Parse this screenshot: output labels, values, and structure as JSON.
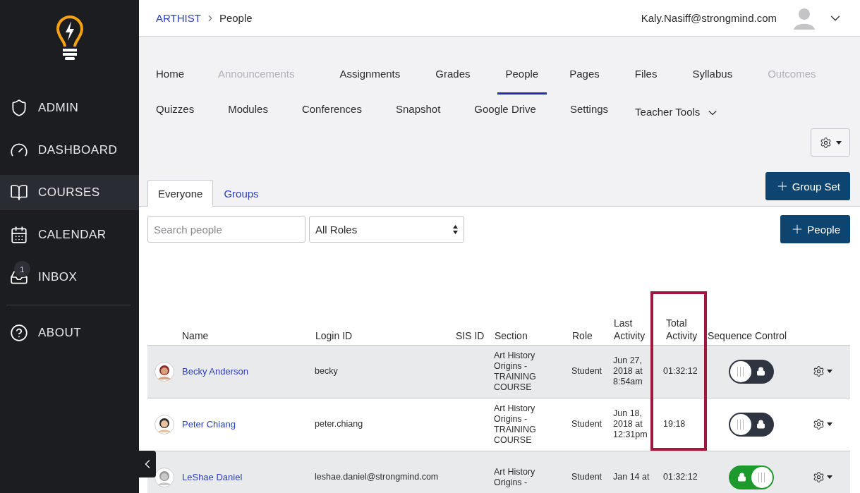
{
  "header": {
    "breadcrumb": [
      {
        "label": "ARTHIST",
        "kind": "link"
      },
      {
        "label": "People",
        "kind": "current"
      }
    ],
    "user_email": "Kaly.Nasiff@strongmind.com"
  },
  "sidebar": {
    "items": [
      {
        "label": "ADMIN",
        "selected": false
      },
      {
        "label": "DASHBOARD",
        "selected": false
      },
      {
        "label": "COURSES",
        "selected": true
      },
      {
        "label": "CALENDAR",
        "selected": false
      },
      {
        "label": "INBOX",
        "selected": false,
        "badge": "1"
      }
    ],
    "footer_items": [
      {
        "label": "ABOUT",
        "selected": false
      }
    ]
  },
  "course_nav": [
    {
      "links": [
        {
          "label": "Home",
          "kind": "link",
          "disabled": false,
          "selected": false
        },
        {
          "label": "Announcements",
          "kind": "link",
          "disabled": true,
          "selected": false
        },
        {
          "label": "Assignments",
          "kind": "link",
          "disabled": false,
          "selected": false
        },
        {
          "label": "Grades",
          "kind": "link",
          "disabled": false,
          "selected": false
        },
        {
          "label": "People",
          "kind": "link",
          "disabled": false,
          "selected": true
        },
        {
          "label": "Pages",
          "kind": "link",
          "disabled": false,
          "selected": false
        },
        {
          "label": "Files",
          "kind": "link",
          "disabled": false,
          "selected": false
        },
        {
          "label": "Syllabus",
          "kind": "link",
          "disabled": false,
          "selected": false
        },
        {
          "label": "Outcomes",
          "kind": "link",
          "disabled": true,
          "selected": false
        }
      ]
    },
    {
      "links": [
        {
          "label": "Quizzes",
          "kind": "link",
          "disabled": false,
          "selected": false
        },
        {
          "label": "Modules",
          "kind": "link",
          "disabled": false,
          "selected": false
        },
        {
          "label": "Conferences",
          "kind": "link",
          "disabled": false,
          "selected": false
        },
        {
          "label": "Snapshot",
          "kind": "link",
          "disabled": false,
          "selected": false
        },
        {
          "label": "Google Drive",
          "kind": "link",
          "disabled": false,
          "selected": false
        },
        {
          "label": "Settings",
          "kind": "link",
          "disabled": false,
          "selected": false
        },
        {
          "label": "Teacher Tools",
          "kind": "dropdown",
          "disabled": false,
          "selected": false
        }
      ]
    }
  ],
  "tabs": [
    {
      "label": "Everyone",
      "selected": true
    },
    {
      "label": "Groups",
      "selected": false
    }
  ],
  "group_set_button": "Group Set",
  "search": {
    "placeholder": "Search people"
  },
  "role_select": {
    "value": "All Roles"
  },
  "add_people_button": "People",
  "table": {
    "columns": [
      {
        "label": "Name",
        "highlighted": false
      },
      {
        "label": "Login ID",
        "highlighted": false
      },
      {
        "label": "SIS ID",
        "highlighted": false
      },
      {
        "label": "Section",
        "highlighted": false
      },
      {
        "label": "Role",
        "highlighted": false
      },
      {
        "label": "Last Activity",
        "highlighted": false
      },
      {
        "label": "Total Activity",
        "highlighted": true
      },
      {
        "label": "Sequence Control",
        "highlighted": false
      }
    ],
    "rows": [
      {
        "name": "Becky Anderson",
        "login_id": "becky",
        "section": "Art History Origins - TRAINING COURSE",
        "role": "Student",
        "last_activity": "Jun 27, 2018 at 8:54am",
        "total_activity": "01:32:12",
        "sequence_on": false
      },
      {
        "name": "Peter Chiang",
        "login_id": "peter.chiang",
        "section": "Art History Origins - TRAINING COURSE",
        "role": "Student",
        "last_activity": "Jun 18, 2018 at 12:31pm",
        "total_activity": "19:18",
        "sequence_on": false
      },
      {
        "name": "LeShae Daniel",
        "login_id": "leshae.daniel@strongmind.com",
        "section": "Art History Origins -",
        "role": "Student",
        "last_activity": "Jan 14 at",
        "total_activity": "01:32:12",
        "sequence_on": true
      }
    ]
  }
}
